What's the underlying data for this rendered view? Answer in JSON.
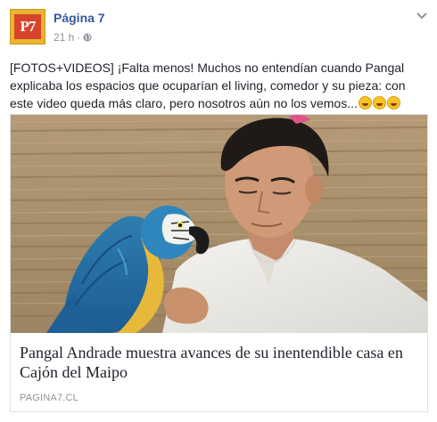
{
  "post": {
    "page_name": "Página 7",
    "avatar_text": "P7",
    "time": "21 h",
    "separator": "·",
    "privacy_icon": "globe-icon",
    "menu_icon": "chevron-down-icon",
    "text": "[FOTOS+VIDEOS] ¡Falta menos! Muchos no entendían cuando Pangal explicaba los espacios que ocuparían el living, comedor y su pieza: con este video queda más claro, pero nosotros aún no los vemos...",
    "emojis": [
      "laughing-emoji",
      "laughing-emoji",
      "laughing-emoji"
    ]
  },
  "link_card": {
    "image_description_icon": "man-with-parrot-photo",
    "title": "Pangal Andrade muestra avances de su inentendible casa en Cajón del Maipo",
    "source": "PAGINA7.CL"
  },
  "colors": {
    "link_blue": "#365899",
    "meta_gray": "#90949c",
    "text": "#1d2129",
    "border": "#dddfe2"
  }
}
